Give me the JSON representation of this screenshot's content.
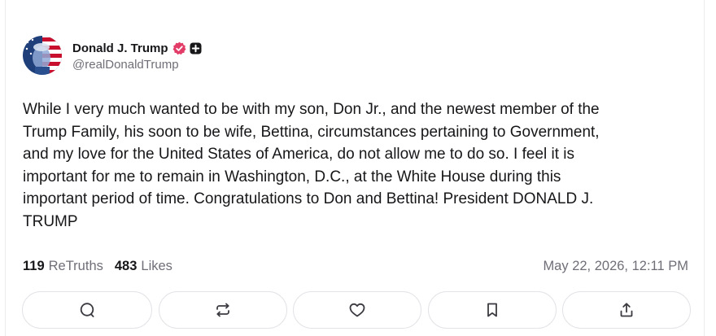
{
  "post": {
    "author": {
      "display_name": "Donald J. Trump",
      "handle": "@realDonaldTrump",
      "verified_badge_icon": "verified-badge-icon",
      "plus_badge_icon": "plus-badge-icon",
      "verified_color": "#e23d68"
    },
    "text": "While I very much wanted to be with my son, Don Jr., and the newest member of the\nTrump Family, his soon to be wife, Bettina, circumstances pertaining to Government,\nand my love for the United States of America, do not allow me to do so. I feel it is\nimportant for me to remain in Washington, D.C., at the White House during this\nimportant period of time. Congratulations to Don and Bettina! President DONALD J.\nTRUMP",
    "stats": {
      "retruths_count": "119",
      "retruths_label": "ReTruths",
      "likes_count": "483",
      "likes_label": "Likes"
    },
    "timestamp": "May 22, 2026, 12:11 PM"
  },
  "actions": [
    {
      "name": "reply",
      "icon": "comment-icon"
    },
    {
      "name": "retruth",
      "icon": "repost-icon"
    },
    {
      "name": "like",
      "icon": "heart-icon"
    },
    {
      "name": "bookmark",
      "icon": "bookmark-icon"
    },
    {
      "name": "share",
      "icon": "share-icon"
    }
  ],
  "colors": {
    "text_primary": "#17171a",
    "text_secondary": "#6f6f78",
    "button_border": "#e3e3e8"
  }
}
